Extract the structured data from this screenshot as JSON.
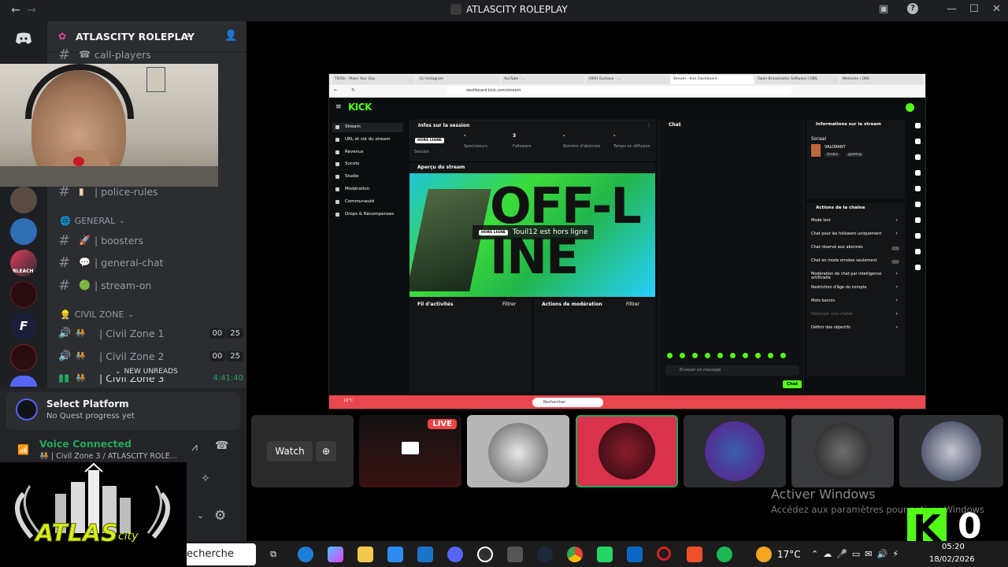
{
  "window": {
    "title": "ATLASCITY ROLEPLAY",
    "back": "←",
    "forward": "→"
  },
  "server": {
    "name": "ATLASCITY ROLEPLAY",
    "dropdown": "⌄",
    "invite_icon": "person-add-icon"
  },
  "channels": {
    "call_players": "call-players",
    "police_rules": "police-rules",
    "general_category": "GENERAL",
    "general_items": [
      {
        "emoji": "🚀",
        "label": "boosters"
      },
      {
        "emoji": "💬",
        "label": "general-chat"
      },
      {
        "emoji": "🟢",
        "label": "stream-on"
      }
    ],
    "civil_category": "CIVIL ZONE",
    "voice": [
      {
        "label": "Civil Zone 1",
        "a": "00",
        "b": "25"
      },
      {
        "label": "Civil Zone 2",
        "a": "00",
        "b": "25"
      },
      {
        "label": "Civil Zone 3",
        "time": "4:41:40"
      }
    ],
    "new_unreads": "NEW UNREADS"
  },
  "quest": {
    "title": "Select Platform",
    "subtitle": "No Quest progress yet"
  },
  "voice_status": {
    "title": "Voice Connected",
    "channel": "Civil Zone 3 / ATLASCITY ROLE..."
  },
  "browser": {
    "tabs": [
      "TikTok - Make Your Day",
      "(1) Instagram",
      "YouTube - ...",
      "(960) Gustavo - ...",
      "Stream - Kick Dashboard",
      "Open Broadcaster Software | OBS",
      "Welcome | OBS"
    ],
    "url": "dashboard.kick.com/stream",
    "kick_logo": "KICK",
    "sidebar": [
      "Stream",
      "URL et clé du stream",
      "Revenus",
      "Sucots",
      "Studio",
      "Modération",
      "Communauté",
      "Drops & Récompenses"
    ],
    "session_title": "Infos sur la session",
    "offline_badge": "HORS LIGNE",
    "stats": [
      {
        "value": "-",
        "label": "Spectateurs"
      },
      {
        "value": "3",
        "label": "Followers"
      },
      {
        "value": "-",
        "label": "Nombre d'abonnés"
      },
      {
        "value": "-",
        "label": "Temps en diffusion"
      }
    ],
    "session_label": "Session",
    "preview_title": "Aperçu du stream",
    "preview_badge": "HORS LIGNE",
    "preview_text": "Touil12 est hors ligne",
    "offline_art": "OFF-LINE",
    "activity_title": "Fil d'activités",
    "activity_filter": "Filtrer",
    "moderation_title": "Actions de modération",
    "moderation_filter": "Filtrer",
    "chat_title": "Chat",
    "chat_placeholder": "Envoyer un message",
    "chat_button": "Chat",
    "info_title": "Informations sur le stream",
    "info_stream_title": "Soraa!",
    "info_category": "VALORANT",
    "info_tags": [
      "Arabic",
      "gaming"
    ],
    "actions_title": "Actions de la chaîne",
    "actions": [
      "Mode lent",
      "Chat pour les followers uniquement",
      "Chat réservé aux abonnés",
      "Chat en mode emotes seulement",
      "Modération de chat par intelligence artificielle",
      "Restriction d'âge du compte",
      "Mots bannis",
      "Héberger une chaîne",
      "Définir des objectifs"
    ],
    "taskbar_search": "Rechercher",
    "weather": "16°C"
  },
  "thumbs": {
    "watch": "Watch",
    "live": "LIVE"
  },
  "activation": {
    "title": "Activer Windows",
    "subtitle": "Accédez aux paramètres pour activer Windows"
  },
  "taskbar": {
    "search": "echerche",
    "temp": "17°C",
    "date": "18/02/2026",
    "clock": "05:20"
  },
  "overlay_k": "K",
  "overlay_zero": "0",
  "logo_text": "ATLAS"
}
